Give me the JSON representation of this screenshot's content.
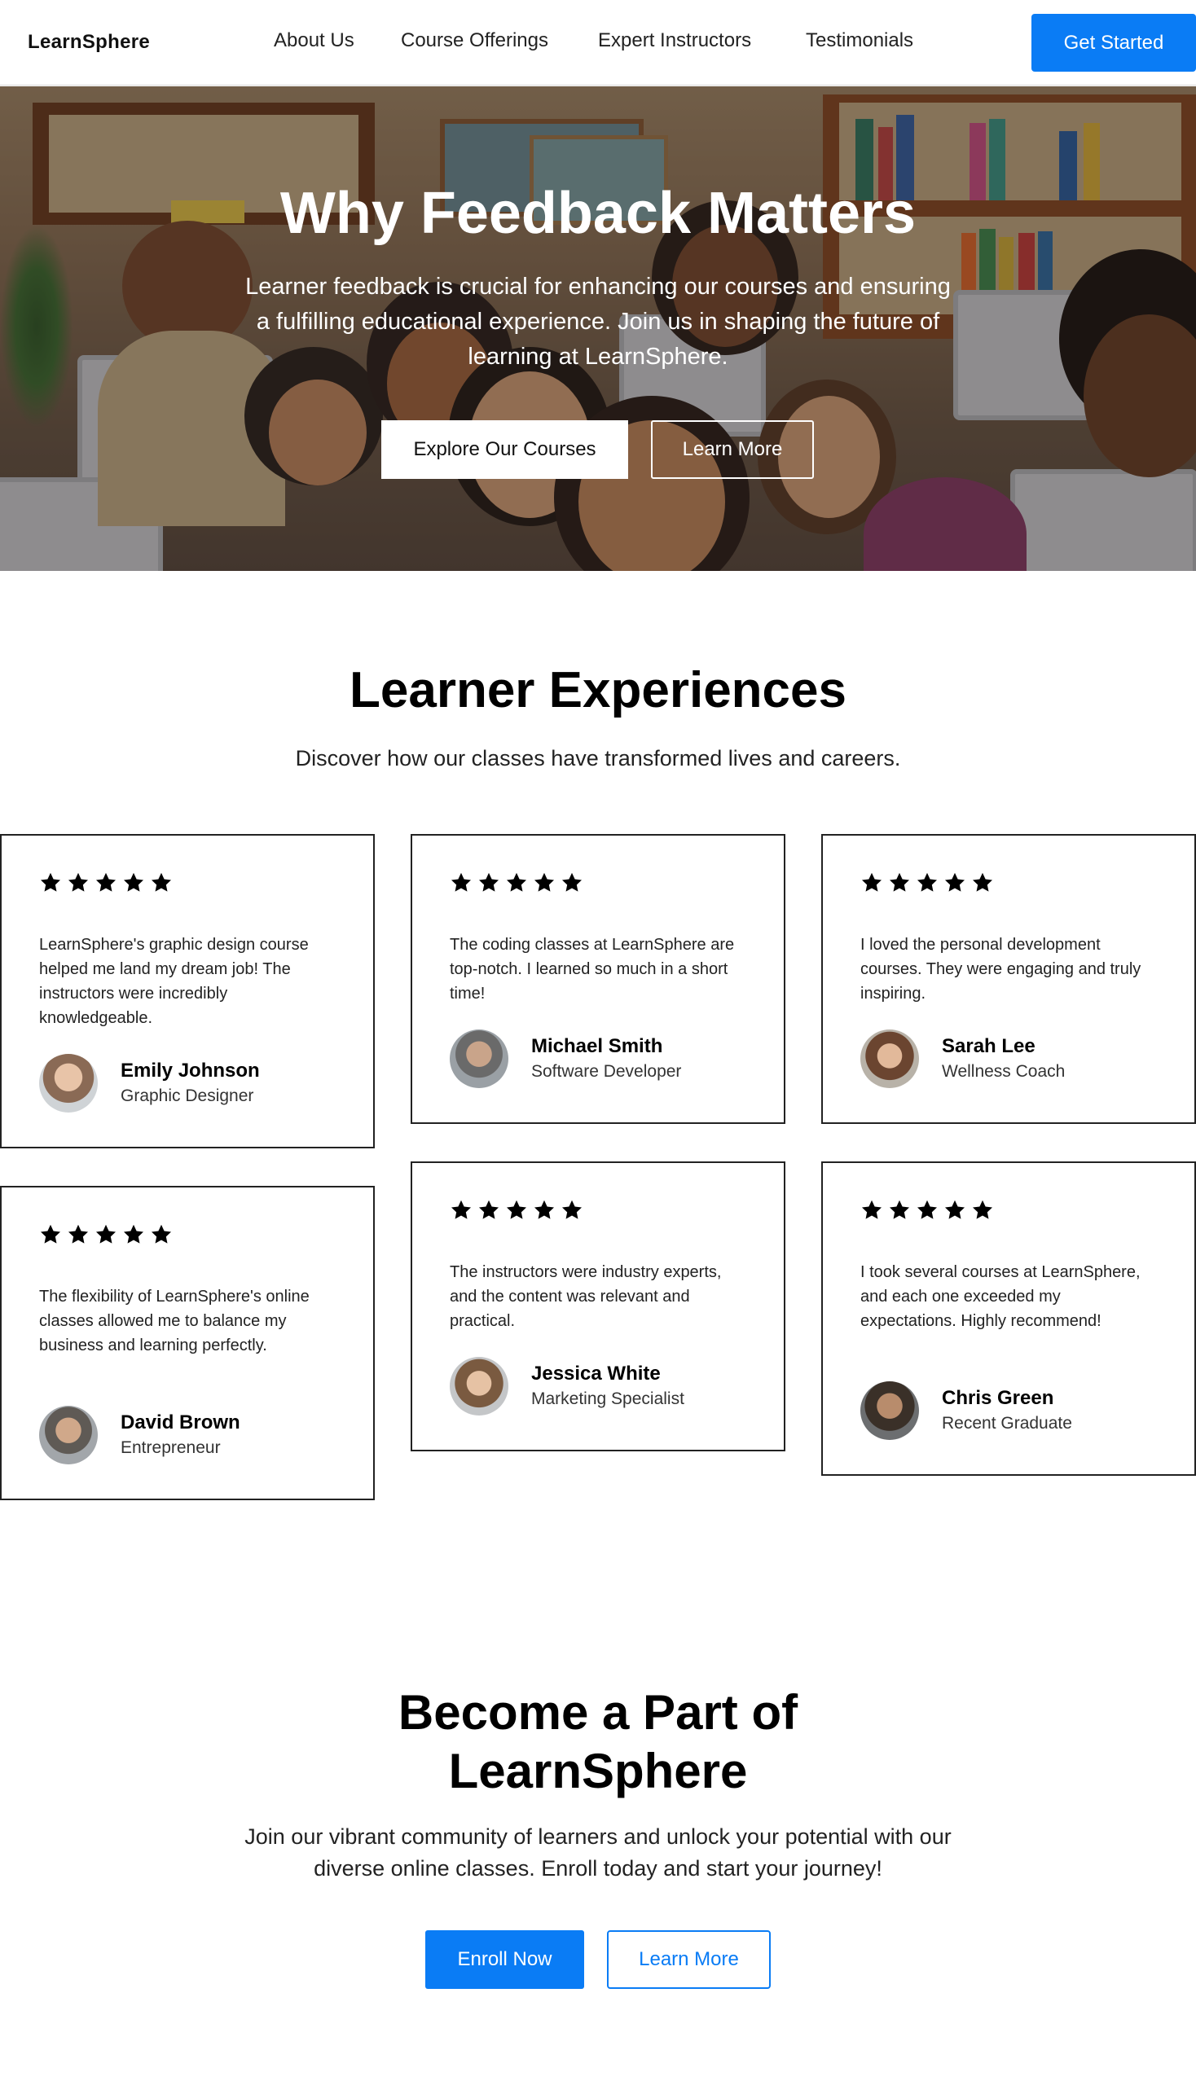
{
  "nav": {
    "logo": "LearnSphere",
    "links": [
      "About Us",
      "Course Offerings",
      "Expert Instructors",
      "Testimonials"
    ],
    "cta": "Get Started"
  },
  "hero": {
    "title": "Why Feedback Matters",
    "subtitle": "Learner feedback is crucial for enhancing our courses and ensuring a fulfilling educational experience. Join us in shaping the future of learning at LearnSphere.",
    "primary_button": "Explore Our Courses",
    "secondary_button": "Learn More"
  },
  "experiences": {
    "title": "Learner Experiences",
    "subtitle": "Discover how our classes have transformed lives and careers.",
    "testimonials": [
      {
        "rating": 5,
        "quote": "LearnSphere's graphic design course helped me land my dream job! The instructors were incredibly knowledgeable.",
        "name": "Emily Johnson",
        "role": "Graphic Designer"
      },
      {
        "rating": 5,
        "quote": "The coding classes at LearnSphere are top-notch. I learned so much in a short time!",
        "name": "Michael Smith",
        "role": "Software Developer"
      },
      {
        "rating": 5,
        "quote": "I loved the personal development courses. They were engaging and truly inspiring.",
        "name": "Sarah Lee",
        "role": "Wellness Coach"
      },
      {
        "rating": 5,
        "quote": "The flexibility of LearnSphere's online classes allowed me to balance my business and learning perfectly.",
        "name": "David Brown",
        "role": "Entrepreneur"
      },
      {
        "rating": 5,
        "quote": "The instructors were industry experts, and the content was relevant and practical.",
        "name": "Jessica White",
        "role": "Marketing Specialist"
      },
      {
        "rating": 5,
        "quote": "I took several courses at LearnSphere, and each one exceeded my expectations. Highly recommend!",
        "name": "Chris Green",
        "role": "Recent Graduate"
      }
    ]
  },
  "join": {
    "title_line1": "Become a Part of",
    "title_line2": "LearnSphere",
    "subtitle": "Join our vibrant community of learners and unlock your potential with our diverse online classes. Enroll today and start your journey!",
    "primary_button": "Enroll Now",
    "secondary_button": "Learn More"
  },
  "colors": {
    "accent": "#0a7cf5",
    "text": "#000000",
    "card_border": "#222222"
  },
  "icons": {
    "rating": "star-icon"
  }
}
